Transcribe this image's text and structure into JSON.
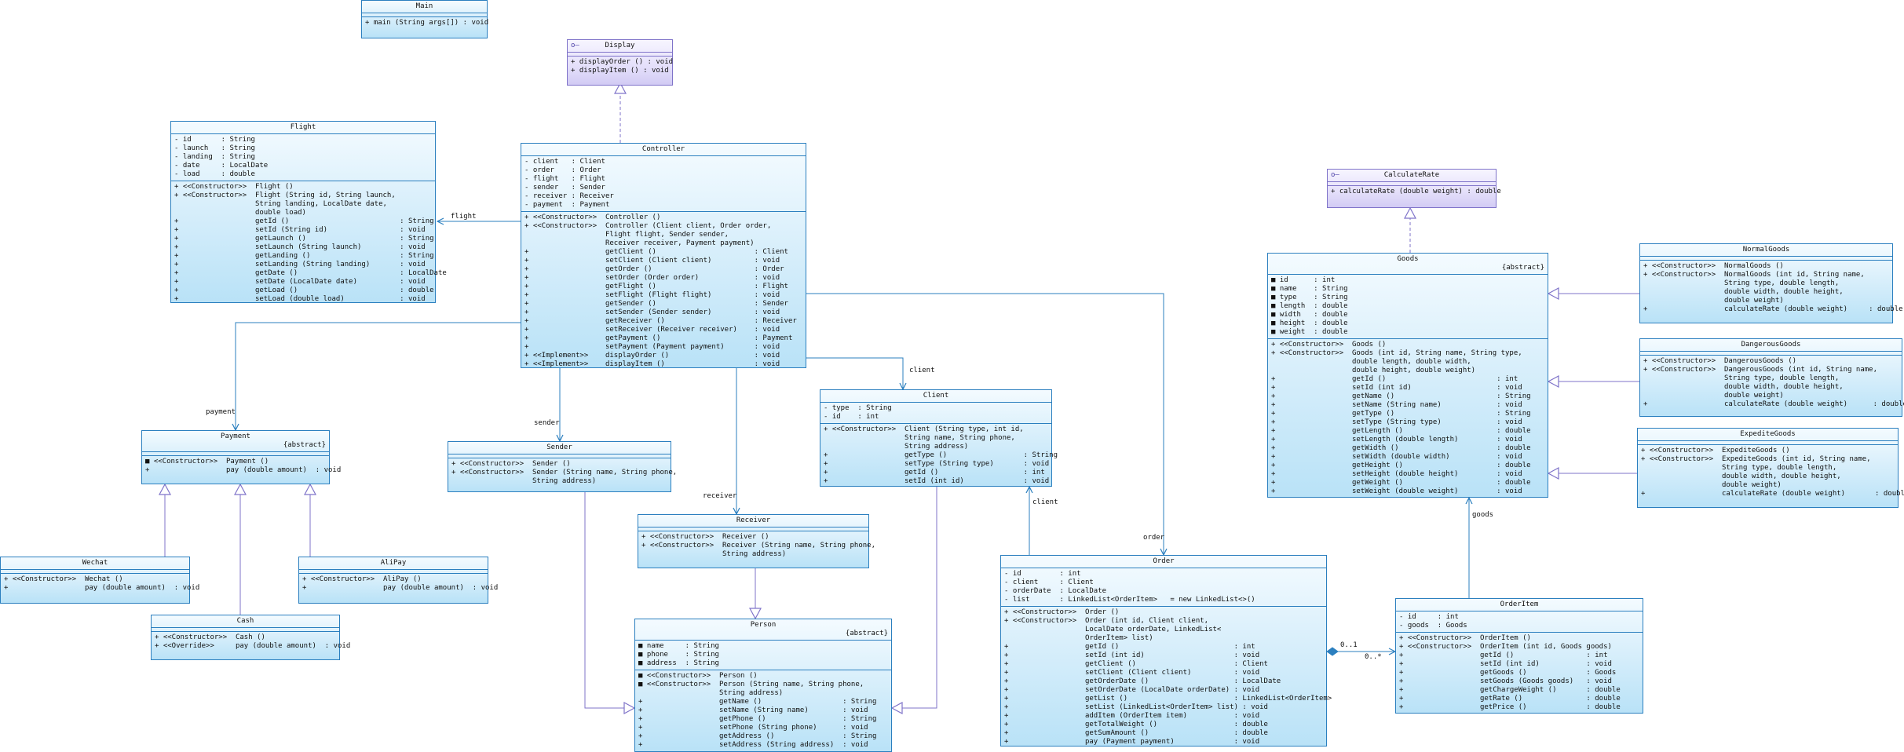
{
  "classes": {
    "main": {
      "name": "Main",
      "stereotype": "",
      "attributes": [],
      "methods": [
        "+ main (String args[]) : void"
      ]
    },
    "display": {
      "name": "Display",
      "stereotype": "",
      "attributes": [],
      "methods": [
        "+ displayOrder () : void",
        "+ displayItem () : void"
      ]
    },
    "flight": {
      "name": "Flight",
      "stereotype": "",
      "attributes": [
        "- id       : String",
        "- launch   : String",
        "- landing  : String",
        "- date     : LocalDate",
        "- load     : double"
      ],
      "methods": [
        "+ <<Constructor>>  Flight ()",
        "+ <<Constructor>>  Flight (String id, String launch,",
        "                   String landing, LocalDate date,",
        "                   double load)",
        "+                  getId ()                          : String",
        "+                  setId (String id)                 : void",
        "+                  getLaunch ()                      : String",
        "+                  setLaunch (String launch)         : void",
        "+                  getLanding ()                     : String",
        "+                  setLanding (String landing)       : void",
        "+                  getDate ()                        : LocalDate",
        "+                  setDate (LocalDate date)          : void",
        "+                  getLoad ()                        : double",
        "+                  setLoad (double load)             : void"
      ]
    },
    "controller": {
      "name": "Controller",
      "stereotype": "",
      "attributes": [
        "- client   : Client",
        "- order    : Order",
        "- flight   : Flight",
        "- sender   : Sender",
        "- receiver : Receiver",
        "- payment  : Payment"
      ],
      "methods": [
        "+ <<Constructor>>  Controller ()",
        "+ <<Constructor>>  Controller (Client client, Order order,",
        "                   Flight flight, Sender sender,",
        "                   Receiver receiver, Payment payment)",
        "+                  getClient ()                       : Client",
        "+                  setClient (Client client)          : void",
        "+                  getOrder ()                        : Order",
        "+                  setOrder (Order order)             : void",
        "+                  getFlight ()                       : Flight",
        "+                  setFlight (Flight flight)          : void",
        "+                  getSender ()                       : Sender",
        "+                  setSender (Sender sender)          : void",
        "+                  getReceiver ()                     : Receiver",
        "+                  setReceiver (Receiver receiver)    : void",
        "+                  getPayment ()                      : Payment",
        "+                  setPayment (Payment payment)       : void",
        "+ <<Implement>>    displayOrder ()                    : void",
        "+ <<Implement>>    displayItem ()                     : void"
      ]
    },
    "calculaterate": {
      "name": "CalculateRate",
      "stereotype": "",
      "attributes": [],
      "methods": [
        "+ calculateRate (double weight) : double"
      ]
    },
    "goods": {
      "name": "Goods",
      "stereotype": "{abstract}",
      "attributes": [
        "■ id      : int",
        "■ name    : String",
        "■ type    : String",
        "■ length  : double",
        "■ width   : double",
        "■ height  : double",
        "■ weight  : double"
      ],
      "methods": [
        "+ <<Constructor>>  Goods ()",
        "+ <<Constructor>>  Goods (int id, String name, String type,",
        "                   double length, double width,",
        "                   double height, double weight)",
        "+                  getId ()                          : int",
        "+                  setId (int id)                    : void",
        "+                  getName ()                        : String",
        "+                  setName (String name)             : void",
        "+                  getType ()                        : String",
        "+                  setType (String type)             : void",
        "+                  getLength ()                      : double",
        "+                  setLength (double length)         : void",
        "+                  getWidth ()                       : double",
        "+                  setWidth (double width)           : void",
        "+                  getHeight ()                      : double",
        "+                  setHeight (double height)         : void",
        "+                  getWeight ()                      : double",
        "+                  setWeight (double weight)         : void"
      ]
    },
    "normalgoods": {
      "name": "NormalGoods",
      "stereotype": "",
      "attributes": [],
      "methods": [
        "+ <<Constructor>>  NormalGoods ()",
        "+ <<Constructor>>  NormalGoods (int id, String name,",
        "                   String type, double length,",
        "                   double width, double height,",
        "                   double weight)",
        "+                  calculateRate (double weight)     : double"
      ]
    },
    "dangerousgoods": {
      "name": "DangerousGoods",
      "stereotype": "",
      "attributes": [],
      "methods": [
        "+ <<Constructor>>  DangerousGoods ()",
        "+ <<Constructor>>  DangerousGoods (int id, String name,",
        "                   String type, double length,",
        "                   double width, double height,",
        "                   double weight)",
        "+                  calculateRate (double weight)      : double"
      ]
    },
    "expeditegoods": {
      "name": "ExpediteGoods",
      "stereotype": "",
      "attributes": [],
      "methods": [
        "+ <<Constructor>>  ExpediteGoods ()",
        "+ <<Constructor>>  ExpediteGoods (int id, String name,",
        "                   String type, double length,",
        "                   double width, double height,",
        "                   double weight)",
        "+                  calculateRate (double weight)       : double"
      ]
    },
    "payment": {
      "name": "Payment",
      "stereotype": "{abstract}",
      "attributes": [],
      "methods": [
        "■ <<Constructor>>  Payment ()",
        "+                  pay (double amount)  : void"
      ]
    },
    "sender": {
      "name": "Sender",
      "stereotype": "",
      "attributes": [],
      "methods": [
        "+ <<Constructor>>  Sender ()",
        "+ <<Constructor>>  Sender (String name, String phone,",
        "                   String address)"
      ]
    },
    "client": {
      "name": "Client",
      "stereotype": "",
      "attributes": [
        "- type  : String",
        "- id    : int"
      ],
      "methods": [
        "+ <<Constructor>>  Client (String type, int id,",
        "                   String name, String phone,",
        "                   String address)",
        "+                  getType ()                  : String",
        "+                  setType (String type)       : void",
        "+                  getId ()                    : int",
        "+                  setId (int id)              : void"
      ]
    },
    "receiver": {
      "name": "Receiver",
      "stereotype": "",
      "attributes": [],
      "methods": [
        "+ <<Constructor>>  Receiver ()",
        "+ <<Constructor>>  Receiver (String name, String phone,",
        "                   String address)"
      ]
    },
    "person": {
      "name": "Person",
      "stereotype": "{abstract}",
      "attributes": [
        "■ name     : String",
        "■ phone    : String",
        "■ address  : String"
      ],
      "methods": [
        "■ <<Constructor>>  Person ()",
        "■ <<Constructor>>  Person (String name, String phone,",
        "                   String address)",
        "+                  getName ()                   : String",
        "+                  setName (String name)        : void",
        "+                  getPhone ()                  : String",
        "+                  setPhone (String phone)      : void",
        "+                  getAddress ()                : String",
        "+                  setAddress (String address)  : void"
      ]
    },
    "order": {
      "name": "Order",
      "stereotype": "",
      "attributes": [
        "- id         : int",
        "- client     : Client",
        "- orderDate  : LocalDate",
        "- list       : LinkedList<OrderItem>   = new LinkedList<>()"
      ],
      "methods": [
        "+ <<Constructor>>  Order ()",
        "+ <<Constructor>>  Order (int id, Client client,",
        "                   LocalDate orderDate, LinkedList<",
        "                   OrderItem> list)",
        "+                  getId ()                           : int",
        "+                  setId (int id)                     : void",
        "+                  getClient ()                       : Client",
        "+                  setClient (Client client)          : void",
        "+                  getOrderDate ()                    : LocalDate",
        "+                  setOrderDate (LocalDate orderDate) : void",
        "+                  getList ()                         : LinkedList<OrderItem>",
        "+                  setList (LinkedList<OrderItem> list) : void",
        "+                  addItem (OrderItem item)           : void",
        "+                  getTotalWeight ()                  : double",
        "+                  getSumAmount ()                    : double",
        "+                  pay (Payment payment)              : void"
      ]
    },
    "orderitem": {
      "name": "OrderItem",
      "stereotype": "",
      "attributes": [
        "- id     : int",
        "- goods  : Goods"
      ],
      "methods": [
        "+ <<Constructor>>  OrderItem ()",
        "+ <<Constructor>>  OrderItem (int id, Goods goods)",
        "+                  getId ()                 : int",
        "+                  setId (int id)           : void",
        "+                  getGoods ()              : Goods",
        "+                  setGoods (Goods goods)   : void",
        "+                  getChargeWeight ()       : double",
        "+                  getRate ()               : double",
        "+                  getPrice ()              : double"
      ]
    },
    "wechat": {
      "name": "Wechat",
      "stereotype": "",
      "attributes": [],
      "methods": [
        "+ <<Constructor>>  Wechat ()",
        "+                  pay (double amount)  : void"
      ]
    },
    "alipay": {
      "name": "AliPay",
      "stereotype": "",
      "attributes": [],
      "methods": [
        "+ <<Constructor>>  AliPay ()",
        "+                  pay (double amount)  : void"
      ]
    },
    "cash": {
      "name": "Cash",
      "stereotype": "",
      "attributes": [],
      "methods": [
        "+ <<Constructor>>  Cash ()",
        "+ <<Override>>     pay (double amount)  : void"
      ]
    }
  },
  "relation_labels": {
    "flight": "flight",
    "payment": "payment",
    "sender": "sender",
    "client_top": "client",
    "receiver": "receiver",
    "client_order": "client",
    "order": "order",
    "goods": "goods",
    "mult_left": "0..1",
    "mult_right": "0..*"
  },
  "colors": {
    "class_border": "#2b7fbf",
    "iface_border": "#7f73c9",
    "assoc_line": "#2b7fbf",
    "realize_line": "#7f73c9"
  }
}
